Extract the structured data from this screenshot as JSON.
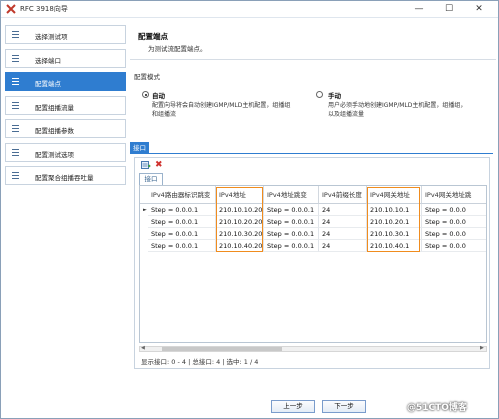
{
  "window": {
    "title": "RFC 3918向导"
  },
  "sidebar": {
    "items": [
      {
        "label": "选择测试项"
      },
      {
        "label": "选择端口"
      },
      {
        "label": "配置端点"
      },
      {
        "label": "配置组播流量"
      },
      {
        "label": "配置组播参数"
      },
      {
        "label": "配置测试选项"
      },
      {
        "label": "配置聚合组播吞吐量"
      }
    ],
    "active_index": 2
  },
  "main": {
    "section_title": "配置端点",
    "section_desc": "为测试流配置端点。",
    "mode_label": "配置模式",
    "modes": [
      {
        "title": "自动",
        "desc_line1": "配置向导将会自动创建IGMP/MLD主机配置，组播组",
        "desc_line2": "和组播流",
        "selected": true
      },
      {
        "title": "手动",
        "desc_line1": "用户必须手动地创建IGMP/MLD主机配置，组播组，",
        "desc_line2": "以及组播流量",
        "selected": false
      }
    ],
    "tab_label": "接口",
    "inner_tab_label": "接口",
    "grid": {
      "columns": [
        "IPv4路由器标识跳变",
        "IPv4地址",
        "IPv4地址跳变",
        "IPv4前缀长度",
        "IPv4网关地址",
        "IPv4网关地址跳"
      ],
      "rows": [
        [
          "Step = 0.0.0.1",
          "210.10.10.20",
          "Step = 0.0.0.1",
          "24",
          "210.10.10.1",
          "Step = 0.0.0"
        ],
        [
          "Step = 0.0.0.1",
          "210.10.20.20",
          "Step = 0.0.0.1",
          "24",
          "210.10.20.1",
          "Step = 0.0.0"
        ],
        [
          "Step = 0.0.0.1",
          "210.10.30.20",
          "Step = 0.0.0.1",
          "24",
          "210.10.30.1",
          "Step = 0.0.0"
        ],
        [
          "Step = 0.0.0.1",
          "210.10.40.20",
          "Step = 0.0.0.1",
          "24",
          "210.10.40.1",
          "Step = 0.0.0"
        ]
      ],
      "current_row_marker": "►"
    },
    "status_text": "显示接口: 0 - 4 | 总接口: 4 | 选中: 1 / 4"
  },
  "footer": {
    "prev_label": "上一步",
    "next_label": "下一步"
  },
  "watermark": "@51CTO博客",
  "colors": {
    "accent": "#2f7dd0",
    "highlight": "#f08c1e",
    "delete": "#d0312d"
  },
  "icons": {
    "add": "add-row-icon",
    "delete": "delete-icon"
  }
}
